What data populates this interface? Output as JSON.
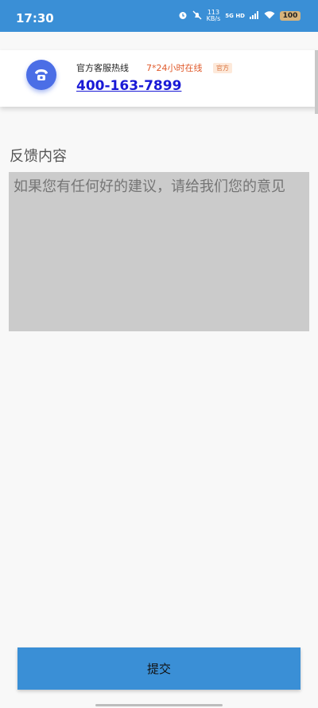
{
  "status_bar": {
    "time": "17:30",
    "speed_value": "113",
    "speed_unit": "KB/s",
    "network": "5G HD",
    "battery": "100",
    "icons": [
      "alarm-icon",
      "mute-icon",
      "signal-icon",
      "wifi-icon",
      "battery-icon"
    ]
  },
  "hotline": {
    "title": "官方客服热线",
    "hours": "7*24小时在线",
    "badge": "官方",
    "number": "400-163-7899",
    "icon": "phone-icon"
  },
  "feedback": {
    "label": "反馈内容",
    "placeholder": "如果您有任何好的建议，请给我们您的意见"
  },
  "submit": {
    "label": "提交"
  },
  "colors": {
    "primary": "#3a8fd6",
    "phone_circle": "#4b6ee6",
    "hours_text": "#e05a2b",
    "link": "#1a1ad6",
    "input_bg": "#cbcbcb"
  }
}
